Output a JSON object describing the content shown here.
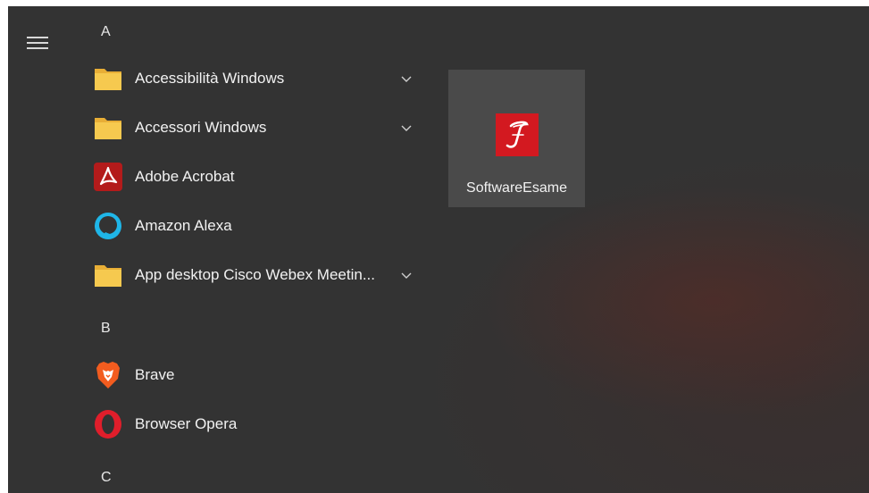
{
  "sidebar": {
    "menu_icon": "hamburger-menu-icon"
  },
  "app_list": {
    "groups": [
      {
        "letter": "A",
        "items": [
          {
            "label": "Accessibilità Windows",
            "icon": "folder-icon",
            "expandable": true
          },
          {
            "label": "Accessori Windows",
            "icon": "folder-icon",
            "expandable": true
          },
          {
            "label": "Adobe Acrobat",
            "icon": "adobe-acrobat-icon",
            "expandable": false
          },
          {
            "label": "Amazon Alexa",
            "icon": "alexa-icon",
            "expandable": false
          },
          {
            "label": "App desktop Cisco Webex Meetin...",
            "icon": "folder-icon",
            "expandable": true
          }
        ]
      },
      {
        "letter": "B",
        "items": [
          {
            "label": "Brave",
            "icon": "brave-lion-icon",
            "expandable": false
          },
          {
            "label": "Browser Opera",
            "icon": "opera-icon",
            "expandable": false
          }
        ]
      },
      {
        "letter": "C",
        "items": []
      }
    ]
  },
  "tiles": [
    {
      "label": "SoftwareEsame",
      "icon": "software-esame-icon",
      "glyph": "𝒥"
    }
  ],
  "colors": {
    "background": "#333333",
    "tile_background": "#4a4a4a",
    "folder_yellow": "#f4c24f",
    "acrobat_red": "#b31b1b",
    "alexa_cyan": "#1fb6e8",
    "opera_red": "#e01e2b",
    "brave_orange": "#f25c1f",
    "tile_icon_red": "#d31920"
  }
}
